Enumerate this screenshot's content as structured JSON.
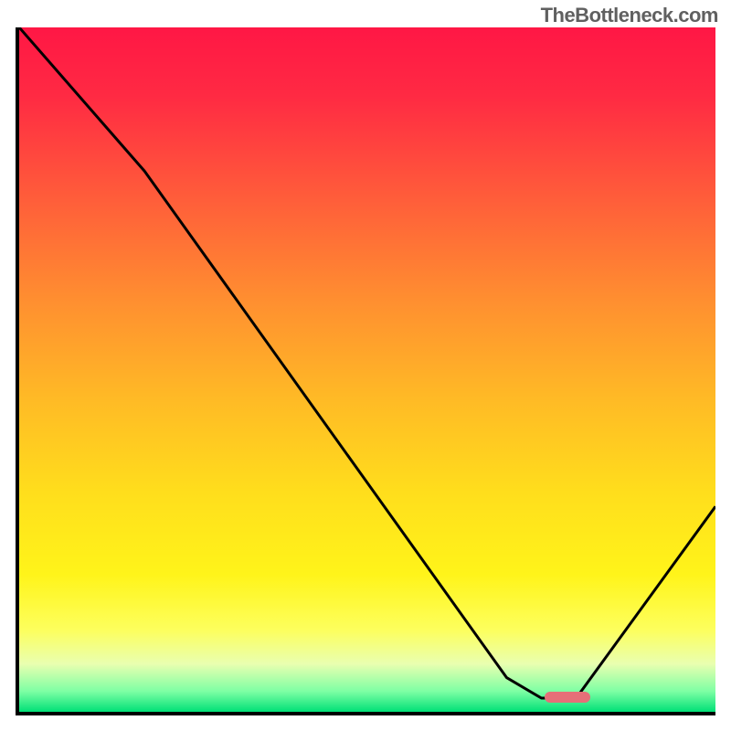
{
  "watermark": "TheBottleneck.com",
  "chart_data": {
    "type": "line",
    "title": "",
    "xlabel": "",
    "ylabel": "",
    "xlim": [
      0,
      100
    ],
    "ylim": [
      0,
      100
    ],
    "x": [
      0,
      18,
      70,
      75,
      80,
      100
    ],
    "values": [
      100,
      79,
      5,
      2,
      2,
      30
    ],
    "marker_range_x": [
      75.5,
      82
    ],
    "gradient_stops": [
      {
        "offset": 0.0,
        "color": "#ff1745"
      },
      {
        "offset": 0.1,
        "color": "#ff2a43"
      },
      {
        "offset": 0.25,
        "color": "#ff5d3a"
      },
      {
        "offset": 0.4,
        "color": "#ff8f30"
      },
      {
        "offset": 0.55,
        "color": "#ffbc25"
      },
      {
        "offset": 0.68,
        "color": "#ffde1c"
      },
      {
        "offset": 0.8,
        "color": "#fff41a"
      },
      {
        "offset": 0.88,
        "color": "#fdff5d"
      },
      {
        "offset": 0.93,
        "color": "#e9ffb0"
      },
      {
        "offset": 0.97,
        "color": "#7effa4"
      },
      {
        "offset": 1.0,
        "color": "#00e077"
      }
    ]
  }
}
